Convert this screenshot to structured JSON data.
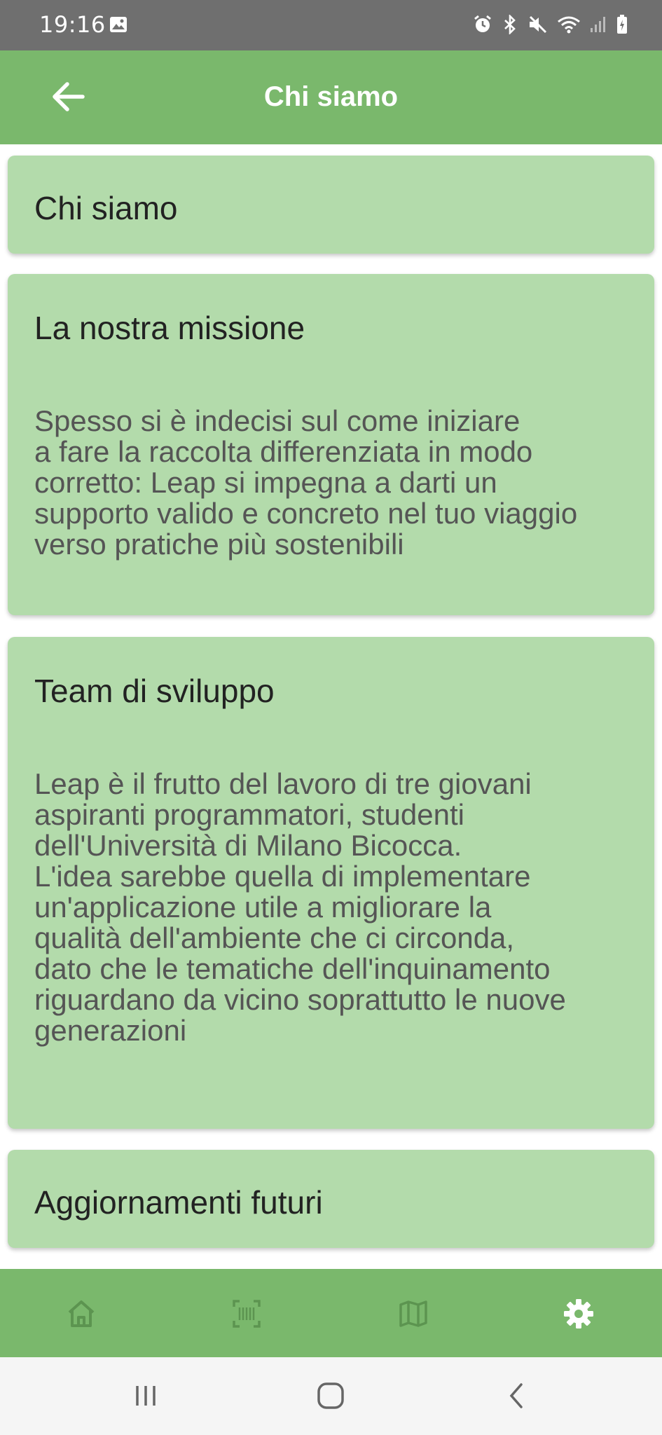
{
  "status_bar": {
    "time": "19:16",
    "icons": [
      "image-icon",
      "alarm-icon",
      "bluetooth-icon",
      "mute-icon",
      "wifi-icon",
      "signal-icon",
      "battery-charging-icon"
    ]
  },
  "app_bar": {
    "title": "Chi siamo",
    "back_icon": "arrow-back-icon"
  },
  "cards": [
    {
      "title": "Chi siamo"
    },
    {
      "title": "La nostra missione",
      "body_lines": [
        "Spesso si è indecisi sul come iniziare",
        "a fare la raccolta differenziata in modo",
        "corretto: Leap si impegna a darti un",
        "supporto valido e concreto nel tuo viaggio",
        "verso pratiche più sostenibili"
      ]
    },
    {
      "title": "Team di sviluppo",
      "body_lines": [
        "Leap è il frutto del lavoro di tre giovani",
        "aspiranti programmatori, studenti",
        "dell'Università di Milano Bicocca.",
        "L'idea sarebbe quella di implementare",
        "un'applicazione utile a migliorare la",
        "qualità dell'ambiente che ci circonda,",
        "dato che le tematiche dell'inquinamento",
        "riguardano da vicino soprattutto le nuove",
        "generazioni"
      ]
    },
    {
      "title": "Aggiornamenti futuri"
    }
  ],
  "bottom_nav": {
    "items": [
      {
        "icon": "home-icon",
        "active": false
      },
      {
        "icon": "barcode-scan-icon",
        "active": false
      },
      {
        "icon": "map-icon",
        "active": false
      },
      {
        "icon": "gear-icon",
        "active": true
      }
    ],
    "inactive_color": "#5c9450",
    "active_color": "#ffffff"
  },
  "colors": {
    "app_bar": "#7ab86c",
    "card": "#b3dbab",
    "status_bar": "#6f6f6f"
  }
}
